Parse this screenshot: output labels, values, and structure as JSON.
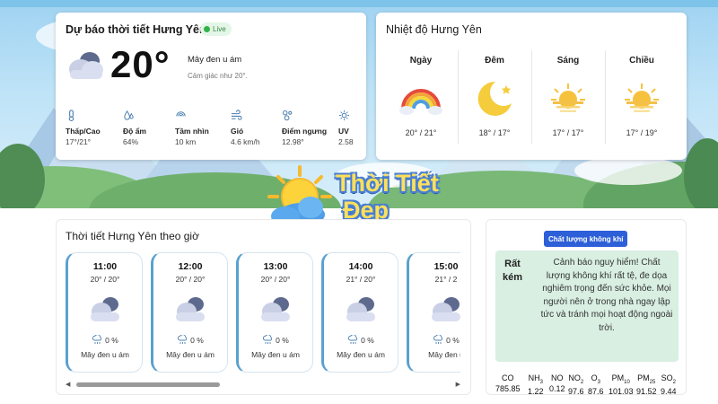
{
  "current": {
    "title": "Dự báo thời tiết Hưng Yên",
    "live_label": "Live",
    "temperature": "20°",
    "description": "Mây đen u ám",
    "feels_like": "Cảm giác như 20°.",
    "metrics": [
      {
        "icon": "thermometer-icon",
        "label": "Thấp/Cao",
        "value": "17°/21°"
      },
      {
        "icon": "humidity-icon",
        "label": "Độ ẩm",
        "value": "64%"
      },
      {
        "icon": "visibility-icon",
        "label": "Tầm nhìn",
        "value": "10 km"
      },
      {
        "icon": "wind-icon",
        "label": "Gió",
        "value": "4.6 km/h"
      },
      {
        "icon": "dew-point-icon",
        "label": "Điểm ngưng",
        "value": "12.98°"
      },
      {
        "icon": "uv-icon",
        "label": "UV",
        "value": "2.58"
      }
    ]
  },
  "temperature_card": {
    "title": "Nhiệt độ Hưng Yên",
    "periods": [
      {
        "name": "Ngày",
        "icon": "rainbow-icon",
        "value": "20° / 21°"
      },
      {
        "name": "Đêm",
        "icon": "moon-icon",
        "value": "18° / 17°"
      },
      {
        "name": "Sáng",
        "icon": "sunrise-icon",
        "value": "17° / 17°"
      },
      {
        "name": "Chiều",
        "icon": "sunset-icon",
        "value": "17° / 19°"
      }
    ]
  },
  "logo": {
    "line1": "Thời Tiết",
    "line2": "Đẹp"
  },
  "hourly": {
    "title": "Thời tiết Hưng Yên theo giờ",
    "hours": [
      {
        "time": "11:00",
        "range": "20° / 20°",
        "precip": "0 %",
        "desc": "Mây đen u ám"
      },
      {
        "time": "12:00",
        "range": "20° / 20°",
        "precip": "0 %",
        "desc": "Mây đen u ám"
      },
      {
        "time": "13:00",
        "range": "20° / 20°",
        "precip": "0 %",
        "desc": "Mây đen u ám"
      },
      {
        "time": "14:00",
        "range": "21° / 20°",
        "precip": "0 %",
        "desc": "Mây đen u ám"
      },
      {
        "time": "15:00",
        "range": "21° / 2",
        "precip": "0 %",
        "desc": "Mây đen u"
      }
    ]
  },
  "air_quality": {
    "badge": "Chất lượng không khí",
    "level": "Rất kém",
    "warning": "Cảnh báo nguy hiểm! Chất lượng không khí rất tệ, đe dọa nghiêm trọng đến sức khỏe. Mọi người nên ở trong nhà ngay lập tức và tránh mọi hoạt động ngoài trời.",
    "pollutants": [
      {
        "name": "CO",
        "sub": "",
        "value": "785.85"
      },
      {
        "name": "NH",
        "sub": "3",
        "value": "1.22"
      },
      {
        "name": "NO",
        "sub": "",
        "value": "0.12"
      },
      {
        "name": "NO",
        "sub": "2",
        "value": "97.6"
      },
      {
        "name": "O",
        "sub": "3",
        "value": "87.6"
      },
      {
        "name": "PM",
        "sub": "10",
        "value": "101.03"
      },
      {
        "name": "PM",
        "sub": "25",
        "value": "91.52"
      },
      {
        "name": "SO",
        "sub": "2",
        "value": "9.44"
      }
    ]
  }
}
